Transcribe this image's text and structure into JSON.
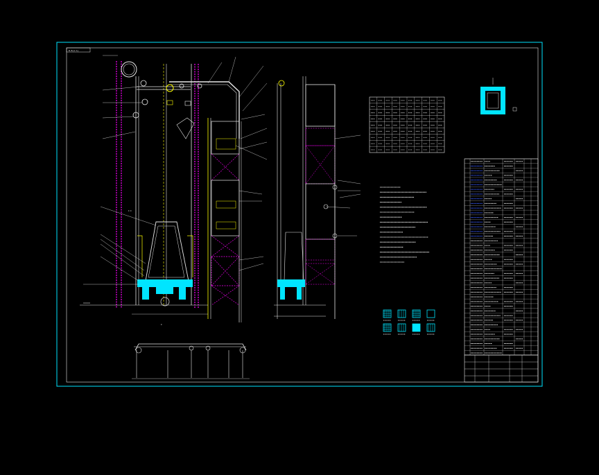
{
  "drawing": {
    "title_tag": "B-B(1:1)",
    "colors": {
      "background": "#000000",
      "frame": "#00e5ff",
      "structure": "#00e5ff",
      "bracing": "#ff00ff",
      "steel": "#ffff00",
      "annotation": "#e8e8e8",
      "hatch_fill": "#00e5ff"
    },
    "section_marks": [
      "I",
      "A",
      "B"
    ],
    "views": [
      {
        "name": "main-elevation"
      },
      {
        "name": "side-elevation"
      },
      {
        "name": "plan-view"
      },
      {
        "name": "section-detail"
      }
    ],
    "legend_swatches": [
      {
        "name": "legend-hatch-1"
      },
      {
        "name": "legend-hatch-2"
      },
      {
        "name": "legend-hatch-3"
      },
      {
        "name": "legend-hatch-4"
      },
      {
        "name": "legend-hatch-5"
      },
      {
        "name": "legend-hatch-6"
      },
      {
        "name": "legend-hatch-7"
      },
      {
        "name": "legend-hatch-8"
      }
    ],
    "material_table_rows": 9,
    "material_table_cols": 10,
    "parts_list_rows": 42,
    "notes_lines": 16,
    "title_block_rows": 4
  }
}
